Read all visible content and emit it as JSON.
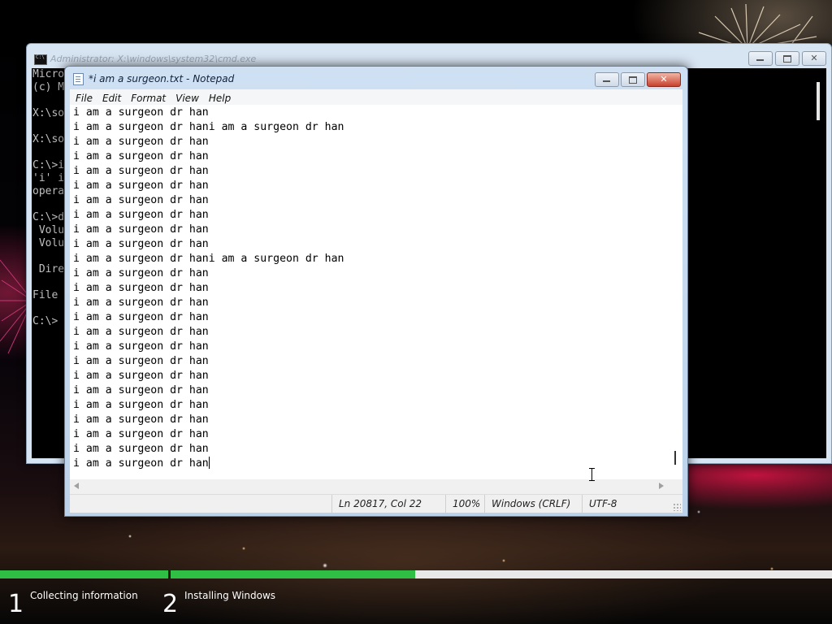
{
  "cmd": {
    "title": "Administrator: X:\\windows\\system32\\cmd.exe",
    "lines": [
      "Micro",
      "(c) M",
      "",
      "X:\\so",
      "",
      "X:\\so",
      "",
      "C:\\>i",
      "'i' i",
      "opera",
      "",
      "C:\\>d",
      " Volu",
      " Volu",
      "",
      " Dire",
      "",
      "File",
      "",
      "C:\\>"
    ]
  },
  "notepad": {
    "title": "*i am a surgeon.txt - Notepad",
    "menu": [
      "File",
      "Edit",
      "Format",
      "View",
      "Help"
    ],
    "lines": [
      "i am a surgeon dr han",
      "i am a surgeon dr hani am a surgeon dr han",
      "i am a surgeon dr han",
      "i am a surgeon dr han",
      "i am a surgeon dr han",
      "i am a surgeon dr han",
      "i am a surgeon dr han",
      "i am a surgeon dr han",
      "i am a surgeon dr han",
      "i am a surgeon dr han",
      "i am a surgeon dr hani am a surgeon dr han",
      "i am a surgeon dr han",
      "i am a surgeon dr han",
      "i am a surgeon dr han",
      "i am a surgeon dr han",
      "i am a surgeon dr han",
      "i am a surgeon dr han",
      "i am a surgeon dr han",
      "i am a surgeon dr han",
      "i am a surgeon dr han",
      "i am a surgeon dr han",
      "i am a surgeon dr han",
      "i am a surgeon dr han",
      "i am a surgeon dr han",
      "i am a surgeon dr han"
    ],
    "status": {
      "position": "Ln 20817, Col 22",
      "zoom": "100%",
      "line_endings": "Windows (CRLF)",
      "encoding": "UTF-8"
    }
  },
  "setup": {
    "steps": [
      {
        "number": "1",
        "label": "Collecting information",
        "progress": 1.0
      },
      {
        "number": "2",
        "label": "Installing Windows",
        "progress": 0.37
      }
    ],
    "accent_color": "#2fbf45"
  },
  "icons": [
    "cmd-icon",
    "notepad-icon",
    "minimize-icon",
    "maximize-icon",
    "close-icon",
    "scroll-left-arrow-icon",
    "scroll-right-arrow-icon",
    "resize-grip-icon",
    "ibeam-cursor-icon"
  ]
}
